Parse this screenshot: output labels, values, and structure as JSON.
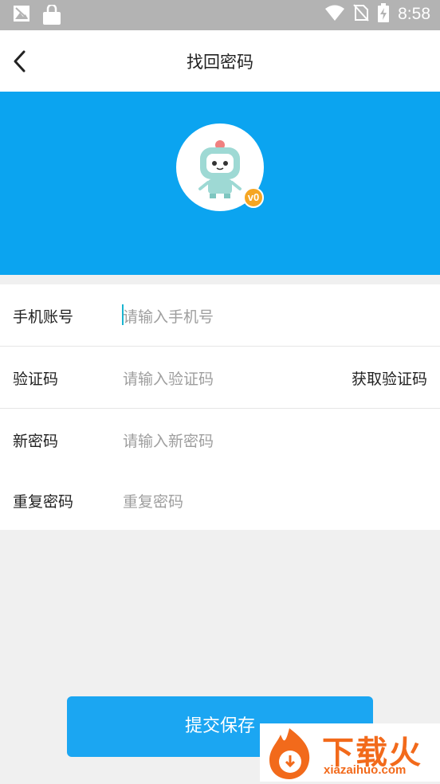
{
  "status_bar": {
    "time": "8:58",
    "icons": [
      "image-icon",
      "shopping-bag-icon",
      "wifi-icon",
      "no-sim-icon",
      "battery-charging-icon"
    ]
  },
  "header": {
    "title": "找回密码",
    "back_icon": "back-arrow-icon"
  },
  "profile": {
    "avatar_icon": "robot-avatar-icon",
    "level_badge": "v0"
  },
  "form": {
    "phone": {
      "label": "手机账号",
      "placeholder": "请输入手机号"
    },
    "code": {
      "label": "验证码",
      "placeholder": "请输入验证码",
      "action": "获取验证码"
    },
    "new_password": {
      "label": "新密码",
      "placeholder": "请输入新密码"
    },
    "repeat_password": {
      "label": "重复密码",
      "placeholder": "重复密码"
    }
  },
  "submit_label": "提交保存",
  "colors": {
    "brand_blue": "#0ba4f0",
    "button_blue": "#1ba6f2",
    "badge_orange": "#f5a623",
    "watermark_orange": "#f26a1b"
  }
}
